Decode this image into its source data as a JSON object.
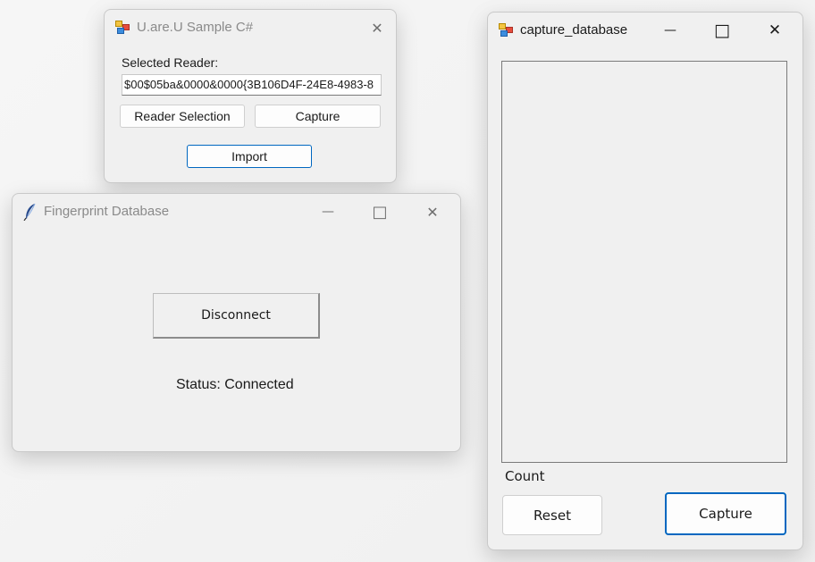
{
  "windows": {
    "sample": {
      "title": "U.are.U Sample C#",
      "selected_reader_label": "Selected Reader:",
      "selected_reader_value": "$00$05ba&0000&0000{3B106D4F-24E8-4983-8",
      "reader_selection_label": "Reader Selection",
      "capture_label": "Capture",
      "import_label": "Import",
      "close_glyph": "✕"
    },
    "fingerprint": {
      "title": "Fingerprint Database",
      "disconnect_label": "Disconnect",
      "status_text": "Status: Connected",
      "minimize_glyph": "—",
      "maximize_glyph": "□",
      "close_glyph": "✕"
    },
    "capture_db": {
      "title": "capture_database",
      "count_label": "Count",
      "reset_label": "Reset",
      "capture_label": "Capture",
      "minimize_glyph": "—",
      "maximize_glyph": "□",
      "close_glyph": "✕"
    }
  },
  "icons": {
    "app_icon": "winforms-app-icon",
    "feather_icon": "tk-feather-icon"
  },
  "colors": {
    "accent": "#0067c0",
    "window_bg": "#f0f0f0",
    "inactive_title": "#8a8a8a"
  }
}
